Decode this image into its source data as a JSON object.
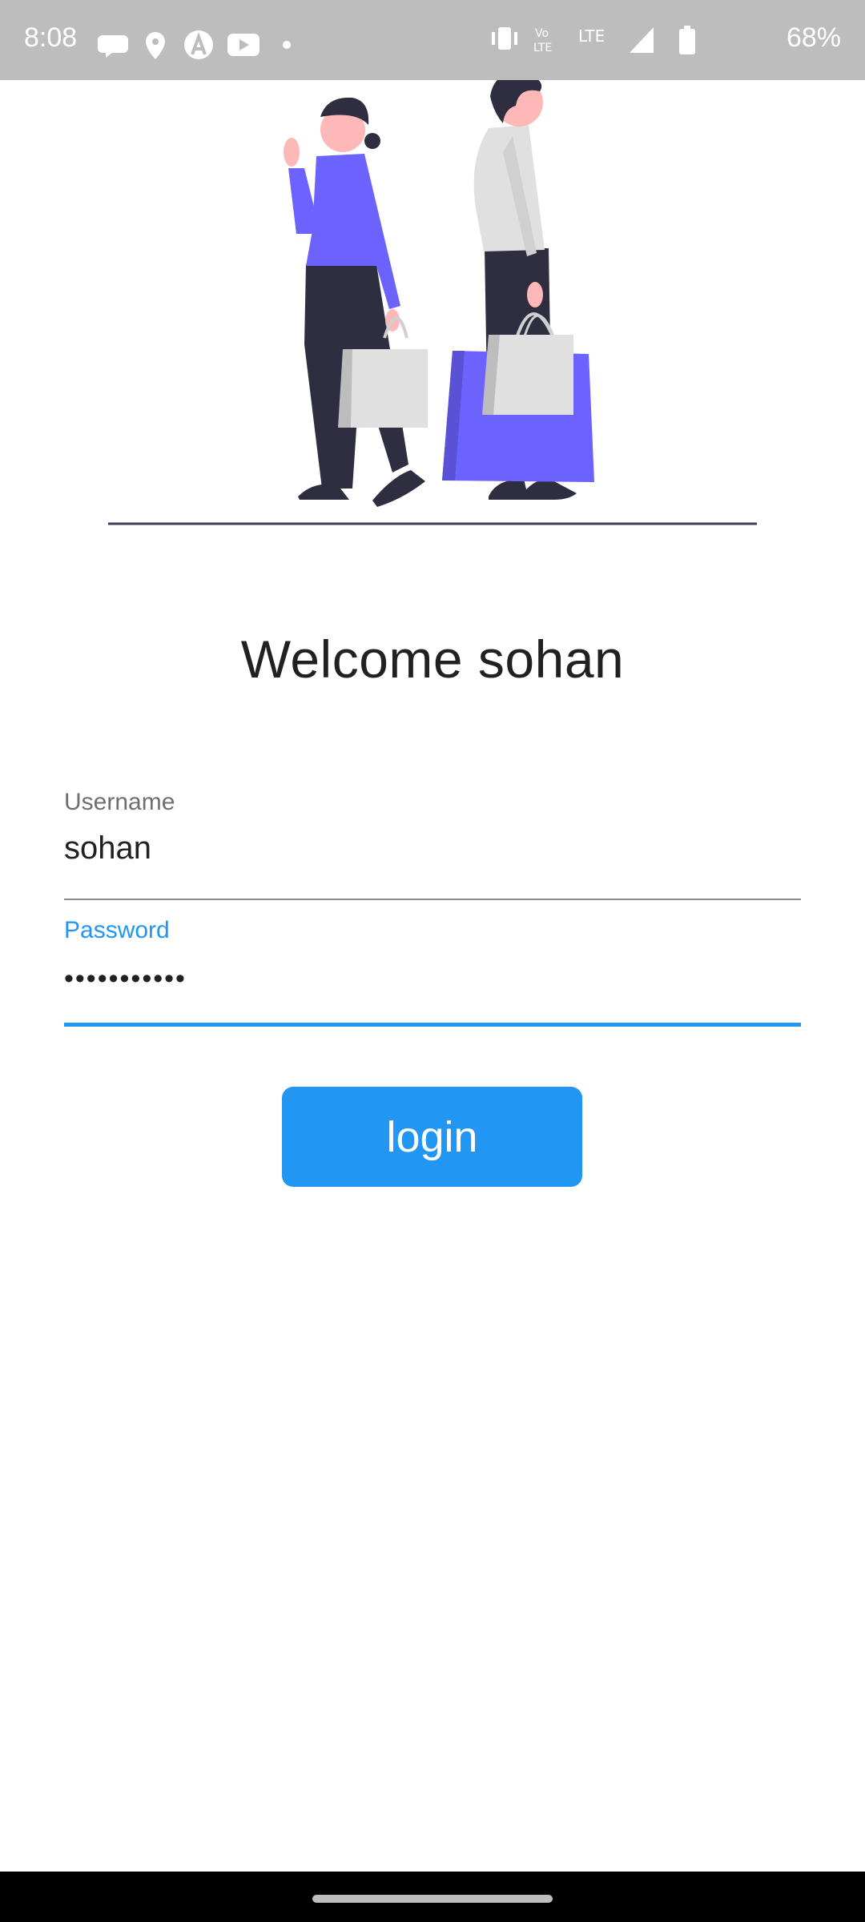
{
  "status_bar": {
    "time": "8:08",
    "battery": "68%",
    "network_label": "LTE",
    "icons": [
      "chat-icon",
      "location-icon",
      "arc-icon",
      "youtube-icon",
      "dot-icon",
      "vibrate-icon",
      "volte-icon",
      "lte-icon",
      "signal-icon",
      "battery-icon"
    ]
  },
  "welcome": {
    "title": "Welcome sohan"
  },
  "form": {
    "username": {
      "label": "Username",
      "value": "sohan"
    },
    "password": {
      "label": "Password",
      "value": "•••••••••••"
    }
  },
  "login_button": {
    "label": "login"
  },
  "colors": {
    "accent": "#2196f3",
    "illustration_purple": "#6c63ff",
    "dark": "#2f2e41"
  }
}
